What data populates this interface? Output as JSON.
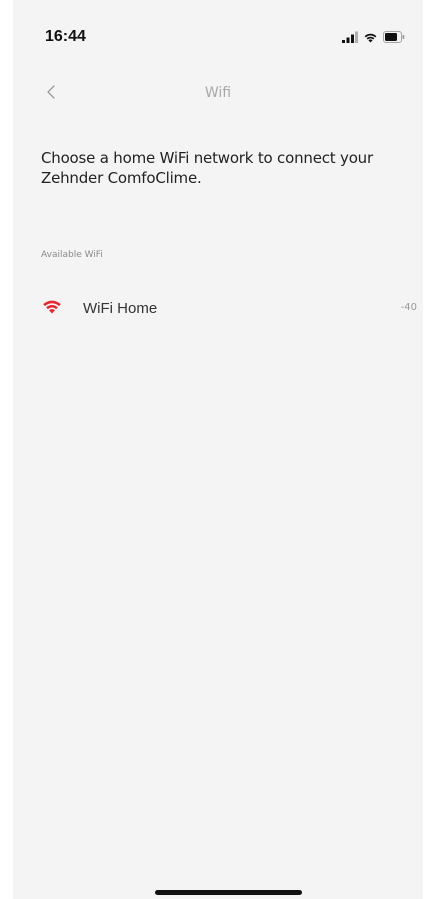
{
  "status_bar": {
    "time": "16:44",
    "icons": [
      "signal-icon",
      "wifi-icon",
      "battery-icon"
    ]
  },
  "nav": {
    "back_icon": "chevron-left-icon",
    "title": "Wifi"
  },
  "instruction": "Choose a home WiFi network to connect your Zehnder ComfoClime.",
  "available_section": {
    "label": "Available WiFi",
    "networks": [
      {
        "name": "WiFi Home",
        "signal": "-40",
        "icon": "wifi-icon"
      }
    ]
  },
  "colors": {
    "accent": "#e3262f",
    "background": "#f4f4f4",
    "text": "#222222",
    "muted": "#a8a8a8"
  }
}
